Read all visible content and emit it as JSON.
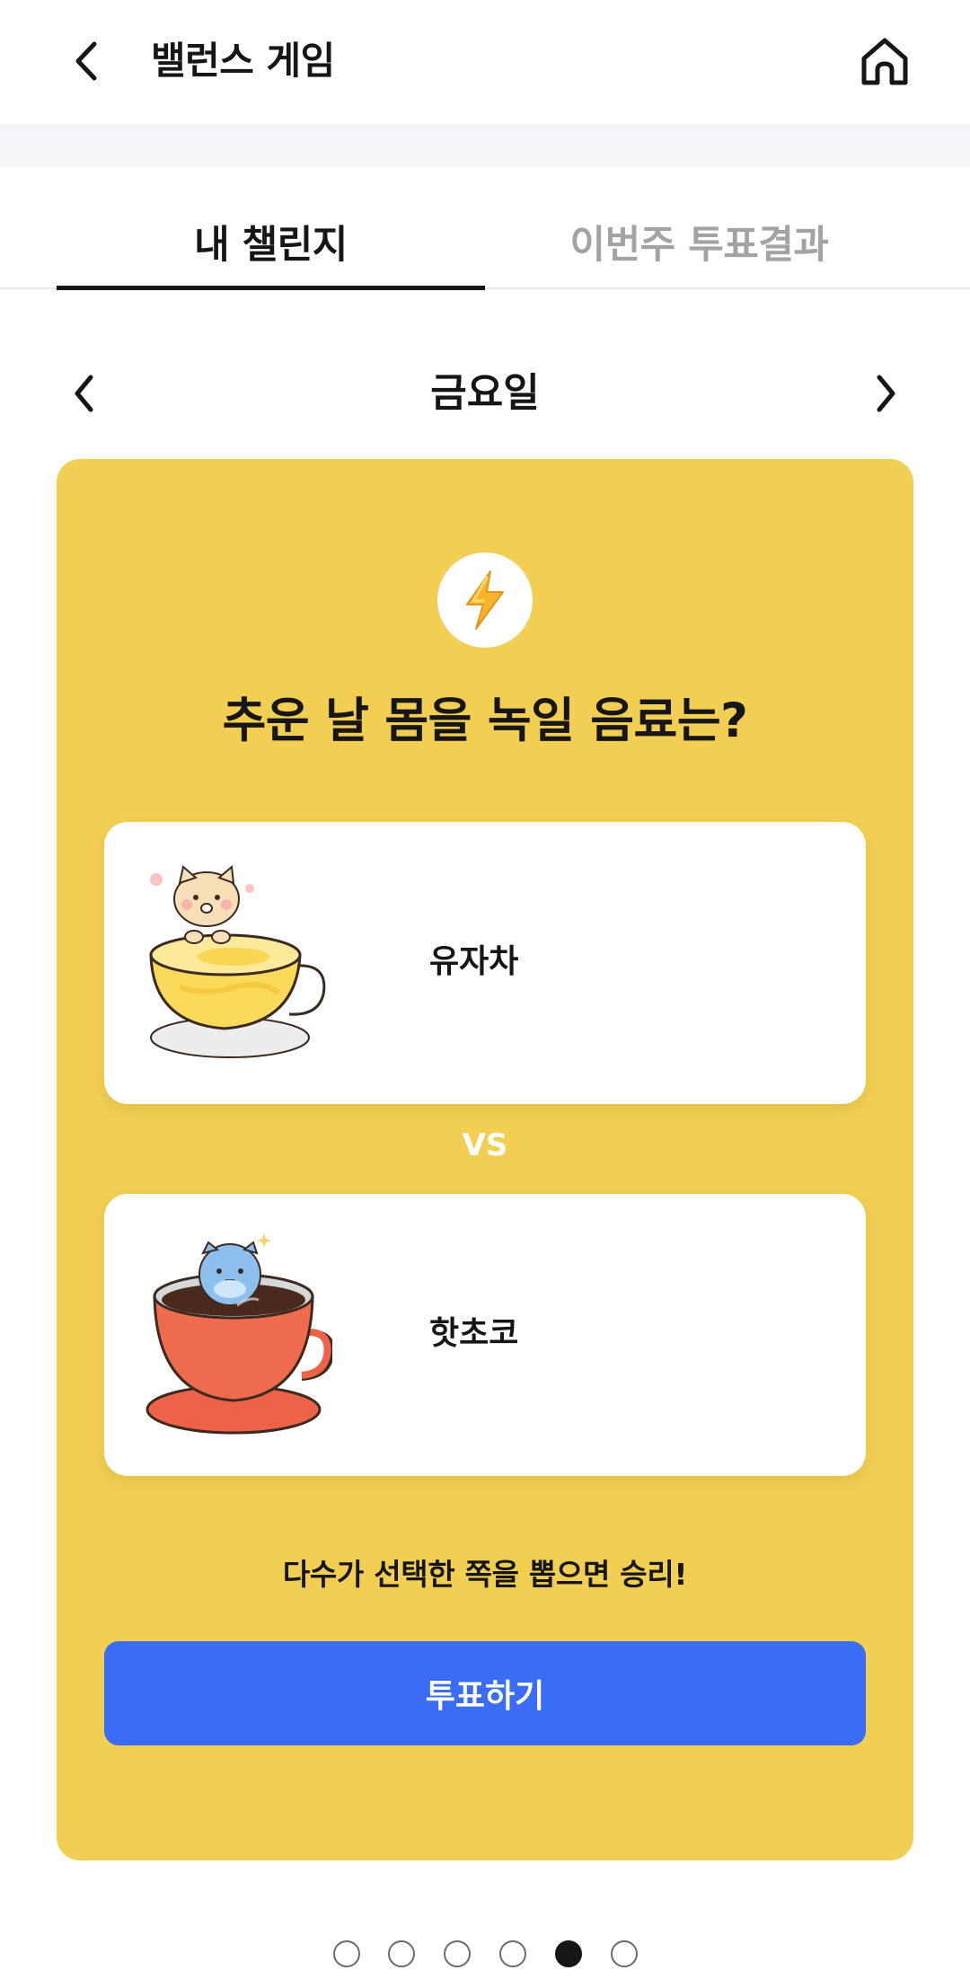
{
  "header": {
    "title": "밸런스 게임",
    "back_icon": "chevron-left-icon",
    "home_icon": "home-icon"
  },
  "tabs": [
    {
      "label": "내 챌린지",
      "active": true
    },
    {
      "label": "이번주 투표결과",
      "active": false
    }
  ],
  "day_nav": {
    "label": "금요일",
    "prev_icon": "chevron-left-icon",
    "next_icon": "chevron-right-icon"
  },
  "challenge": {
    "badge_icon": "lightning-bolt-icon",
    "question": "추운 날 몸을 녹일 음료는?",
    "option_a": {
      "label": "유자차",
      "illustration": "citron-tea-cup-with-cat-icon"
    },
    "vs_label": "VS",
    "option_b": {
      "label": "핫초코",
      "illustration": "hot-chocolate-cup-with-bird-icon"
    },
    "rule_text": "다수가 선택한 쪽을 뽑으면 승리!",
    "vote_button": "투표하기"
  },
  "pager": {
    "count": 6,
    "active_index": 4
  },
  "colors": {
    "card_background": "#f2cf52",
    "vote_button": "#3a6cf5",
    "tab_active": "#161616",
    "tab_inactive": "#a3a3a6"
  }
}
